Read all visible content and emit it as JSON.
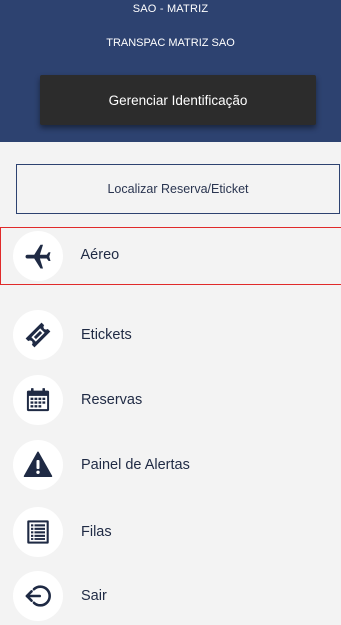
{
  "header": {
    "branch_code": "SAO - MATRIZ",
    "branch_name": "TRANSPAC MATRIZ SAO",
    "manage_button_label": "Gerenciar Identificação"
  },
  "find_button_label": "Localizar Reserva/Eticket",
  "menu": {
    "active_item": "Aéreo",
    "items": [
      {
        "label": "Aéreo",
        "icon": "airplane-icon"
      },
      {
        "label": "Etickets",
        "icon": "ticket-icon"
      },
      {
        "label": "Reservas",
        "icon": "calendar-icon"
      },
      {
        "label": "Painel de Alertas",
        "icon": "warning-icon"
      },
      {
        "label": "Filas",
        "icon": "list-icon"
      },
      {
        "label": "Sair",
        "icon": "exit-icon"
      }
    ]
  },
  "colors": {
    "header_background": "#2d4270",
    "button_dark": "#2c2c2c",
    "active_outline": "#e02a2a",
    "icon_color": "#1f2a44"
  }
}
